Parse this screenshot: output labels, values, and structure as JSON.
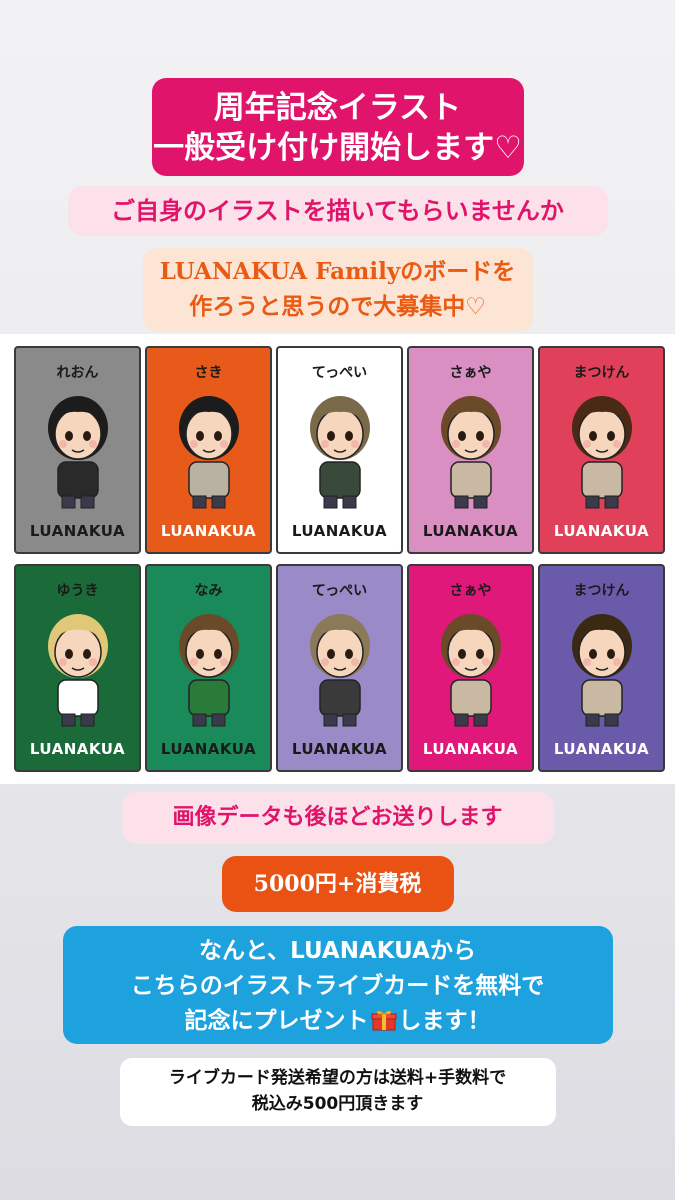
{
  "title": {
    "line1": "周年記念イラスト",
    "line2": "一般受け付け開始します♡"
  },
  "subtitle": "ご自身のイラストを描いてもらいませんか",
  "recruit": {
    "line1": "LUANAKUA Familyのボードを",
    "line2": "作ろうと思うので大募集中♡"
  },
  "board": {
    "logo": "LUANAKUA",
    "cards": [
      {
        "name": "れおん",
        "bg": "#8a8a8a",
        "logo_color": "#1a1a1a",
        "hair": "#1c1c1c",
        "shirt": "#2a2a2a"
      },
      {
        "name": "さき",
        "bg": "#e85a1a",
        "logo_color": "#ffffff",
        "hair": "#1c1c1c",
        "shirt": "#b9b1a2"
      },
      {
        "name": "てっぺい",
        "bg": "#ffffff",
        "logo_color": "#1a1a1a",
        "hair": "#7a6a4a",
        "shirt": "#3a4a3a"
      },
      {
        "name": "さぁや",
        "bg": "#d98fc2",
        "logo_color": "#1a1a1a",
        "hair": "#6b4a2a",
        "shirt": "#c9b9a2"
      },
      {
        "name": "まつけん",
        "bg": "#e0405a",
        "logo_color": "#ffffff",
        "hair": "#4a2a14",
        "shirt": "#c9b9a2"
      },
      {
        "name": "ゆうき",
        "bg": "#1a6a3a",
        "logo_color": "#ffffff",
        "hair": "#e0c878",
        "shirt": "#ffffff"
      },
      {
        "name": "なみ",
        "bg": "#1a8a5a",
        "logo_color": "#1a1a1a",
        "hair": "#6b4a2a",
        "shirt": "#2a7a3a"
      },
      {
        "name": "てっぺい",
        "bg": "#9a8ac8",
        "logo_color": "#1a1a1a",
        "hair": "#8a7a5a",
        "shirt": "#3a3a3a"
      },
      {
        "name": "さぁや",
        "bg": "#e0187a",
        "logo_color": "#ffffff",
        "hair": "#6b4a2a",
        "shirt": "#c9b9a2"
      },
      {
        "name": "まつけん",
        "bg": "#6a5aaa",
        "logo_color": "#ffffff",
        "hair": "#3a2a14",
        "shirt": "#c9b9a2"
      }
    ]
  },
  "image_data_note": "画像データも後ほどお送りします",
  "price": "5000円+消費税",
  "present": {
    "line1": "なんと、LUANAKUAから",
    "line2": "こちらのイラストライブカードを無料で",
    "line3a": "記念にプレゼント",
    "gift_icon": "gift-box-icon",
    "line3b": "します！"
  },
  "shipping": {
    "line1": "ライブカード発送希望の方は送料+手数料で",
    "line2": "税込み500円頂きます"
  }
}
